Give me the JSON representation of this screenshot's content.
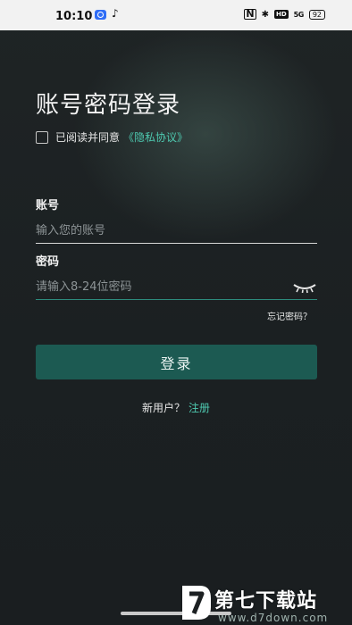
{
  "status_bar": {
    "time": "10:10",
    "app_icon_1": "browser-icon",
    "app_icon_2": "tiktok-icon",
    "nfc": "N",
    "bluetooth": "✱",
    "hd": "HD",
    "signal": "5G",
    "battery": "92"
  },
  "login": {
    "title": "账号密码登录",
    "agree_text": "已阅读并同意",
    "agree_link": "《隐私协议》",
    "account_label": "账号",
    "account_placeholder": "输入您的账号",
    "password_label": "密码",
    "password_placeholder": "请输入8-24位密码",
    "forgot_password": "忘记密码？",
    "login_button": "登录",
    "register_prompt": "新用户？",
    "register_link": "注册"
  },
  "watermark": {
    "name": "第七下载站",
    "url": "www.d7down.com"
  },
  "colors": {
    "accent": "#4ec9b0",
    "button": "#1c5a52",
    "background": "#1c2022"
  }
}
